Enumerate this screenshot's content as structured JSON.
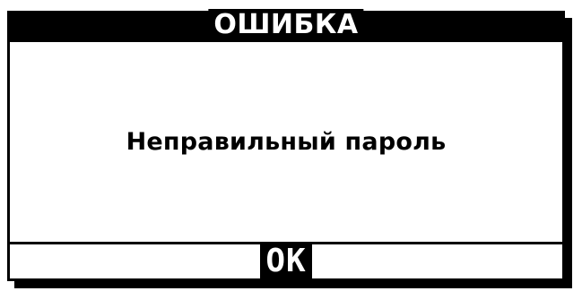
{
  "dialog": {
    "title": "ОШИБКА",
    "message": "Неправильный пароль",
    "ok_label": "OK"
  },
  "colors": {
    "frame": "#000000",
    "background": "#ffffff",
    "title_text": "#ffffff",
    "message_text": "#000000"
  }
}
